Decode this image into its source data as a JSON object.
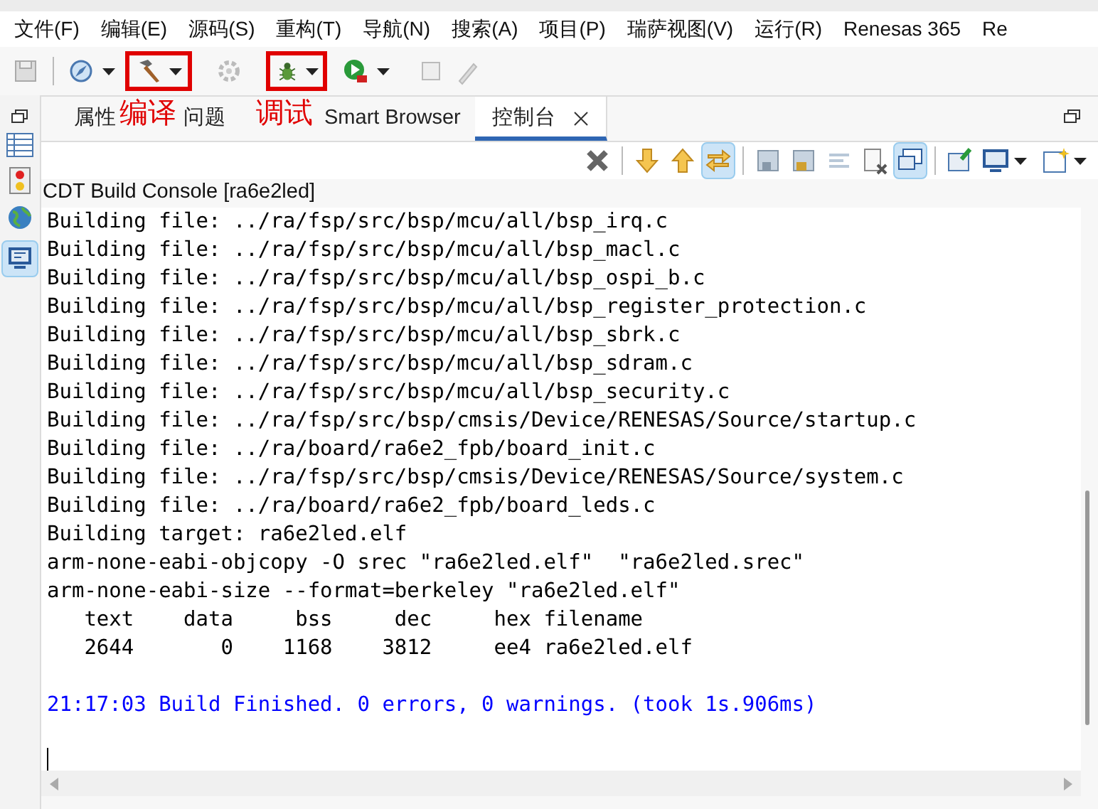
{
  "menu": [
    "文件(F)",
    "编辑(E)",
    "源码(S)",
    "重构(T)",
    "导航(N)",
    "搜索(A)",
    "项目(P)",
    "瑞萨视图(V)",
    "运行(R)",
    "Renesas 365",
    "Re"
  ],
  "annotations": [
    {
      "label": "编译"
    },
    {
      "label": "调试"
    }
  ],
  "tabs": [
    {
      "label": "属性",
      "selected": false
    },
    {
      "label": "问题",
      "selected": false
    },
    {
      "label": "Smart Browser",
      "selected": false
    },
    {
      "label": "控制台",
      "selected": true
    }
  ],
  "console": {
    "title": "CDT Build Console [ra6e2led]",
    "lines": [
      {
        "kind": "output",
        "text": "Building file: ../ra/fsp/src/bsp/mcu/all/bsp_irq.c"
      },
      {
        "kind": "output",
        "text": "Building file: ../ra/fsp/src/bsp/mcu/all/bsp_macl.c"
      },
      {
        "kind": "output",
        "text": "Building file: ../ra/fsp/src/bsp/mcu/all/bsp_ospi_b.c"
      },
      {
        "kind": "output",
        "text": "Building file: ../ra/fsp/src/bsp/mcu/all/bsp_register_protection.c"
      },
      {
        "kind": "output",
        "text": "Building file: ../ra/fsp/src/bsp/mcu/all/bsp_sbrk.c"
      },
      {
        "kind": "output",
        "text": "Building file: ../ra/fsp/src/bsp/mcu/all/bsp_sdram.c"
      },
      {
        "kind": "output",
        "text": "Building file: ../ra/fsp/src/bsp/mcu/all/bsp_security.c"
      },
      {
        "kind": "output",
        "text": "Building file: ../ra/fsp/src/bsp/cmsis/Device/RENESAS/Source/startup.c"
      },
      {
        "kind": "output",
        "text": "Building file: ../ra/board/ra6e2_fpb/board_init.c"
      },
      {
        "kind": "output",
        "text": "Building file: ../ra/fsp/src/bsp/cmsis/Device/RENESAS/Source/system.c"
      },
      {
        "kind": "output",
        "text": "Building file: ../ra/board/ra6e2_fpb/board_leds.c"
      },
      {
        "kind": "output",
        "text": "Building target: ra6e2led.elf"
      },
      {
        "kind": "output",
        "text": "arm-none-eabi-objcopy -O srec \"ra6e2led.elf\"  \"ra6e2led.srec\""
      },
      {
        "kind": "output",
        "text": "arm-none-eabi-size --format=berkeley \"ra6e2led.elf\""
      },
      {
        "kind": "output",
        "text": "   text    data     bss     dec     hex filename"
      },
      {
        "kind": "output",
        "text": "   2644       0    1168    3812     ee4 ra6e2led.elf"
      },
      {
        "kind": "blank"
      },
      {
        "kind": "status",
        "text": "21:17:03 Build Finished. 0 errors, 0 warnings. (took 1s.906ms)"
      }
    ]
  }
}
